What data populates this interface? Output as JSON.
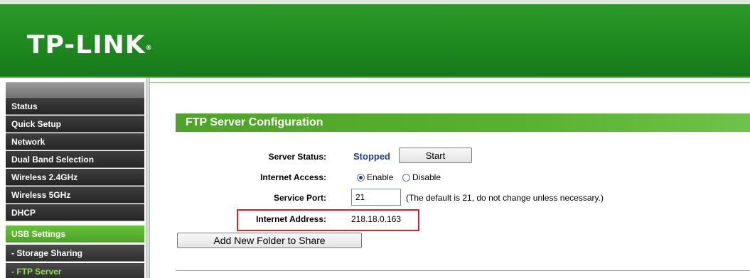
{
  "header": {
    "logo": "TP-LINK",
    "logo_mark": "®"
  },
  "sidebar": {
    "items": [
      {
        "label": "Status"
      },
      {
        "label": "Quick Setup"
      },
      {
        "label": "Network"
      },
      {
        "label": "Dual Band Selection"
      },
      {
        "label": "Wireless 2.4GHz"
      },
      {
        "label": "Wireless 5GHz"
      },
      {
        "label": "DHCP"
      },
      {
        "label": "USB Settings"
      },
      {
        "label": "- Storage Sharing"
      },
      {
        "label": "- FTP Server"
      }
    ]
  },
  "ftp": {
    "section_title": "FTP Server Configuration",
    "server_status_label": "Server Status:",
    "server_status_value": "Stopped",
    "start_button": "Start",
    "internet_access_label": "Internet Access:",
    "enable_label": "Enable",
    "disable_label": "Disable",
    "internet_access_selected": "Enable",
    "service_port_label": "Service Port:",
    "service_port_value": "21",
    "service_port_hint": "(The default is 21, do not change unless necessary.)",
    "internet_address_label": "Internet Address:",
    "internet_address_value": "218.18.0.163",
    "add_folder_button": "Add New Folder to Share"
  },
  "colors": {
    "brand_green": "#1f8a1f",
    "section_green": "#4ea427",
    "highlight_red": "#d9232a",
    "status_blue": "#1f3f8f"
  }
}
